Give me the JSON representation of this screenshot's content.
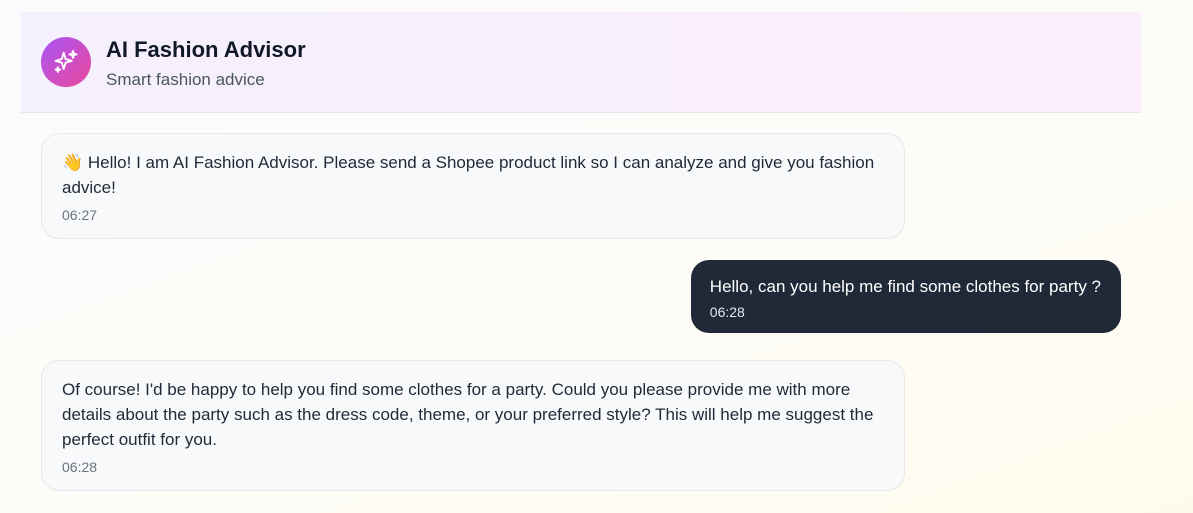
{
  "header": {
    "title": "AI Fashion Advisor",
    "subtitle": "Smart fashion advice",
    "avatar_icon": "sparkles-icon"
  },
  "colors": {
    "avatar_gradient": [
      "#a855f7",
      "#ec4899"
    ],
    "user_bubble": "#1f2937",
    "bot_bubble": "#f8f9fb"
  },
  "messages": [
    {
      "role": "bot",
      "text": "👋 Hello! I am AI Fashion Advisor. Please send a Shopee product link so I can analyze and give you fashion advice!",
      "time": "06:27"
    },
    {
      "role": "user",
      "text": "Hello, can you help me find some clothes for party ?",
      "time": "06:28"
    },
    {
      "role": "bot",
      "text": "Of course! I'd be happy to help you find some clothes for a party. Could you please provide me with more details about the party such as the dress code, theme, or your preferred style? This will help me suggest the perfect outfit for you.",
      "time": "06:28"
    }
  ]
}
